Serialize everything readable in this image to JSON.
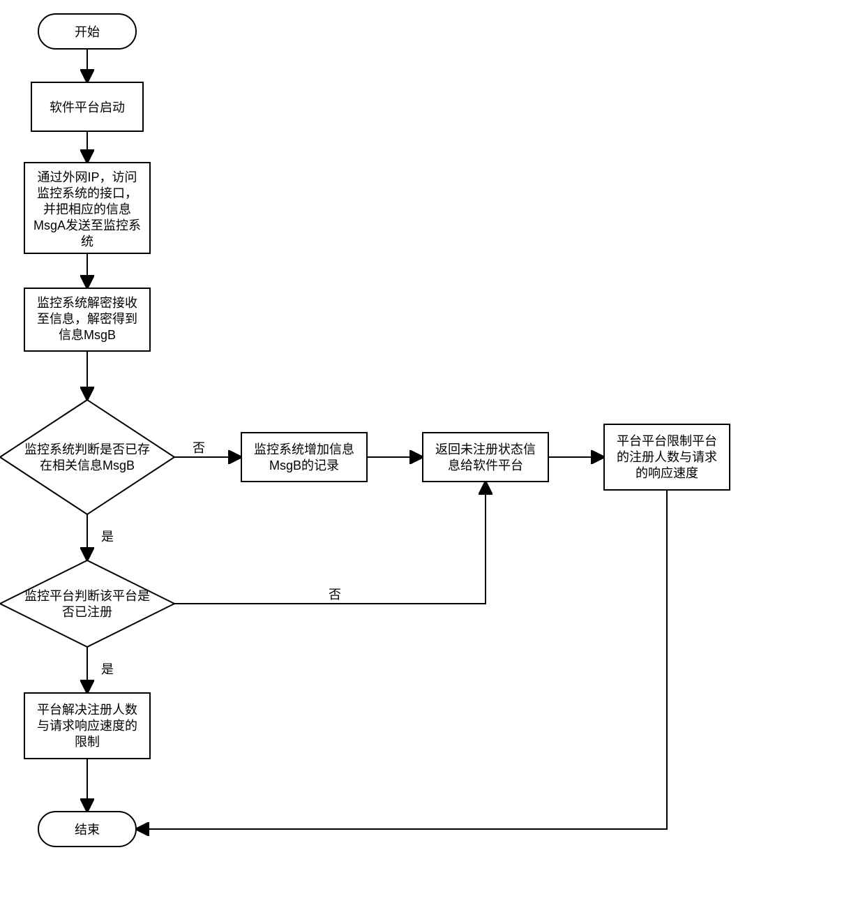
{
  "nodes": {
    "start": "开始",
    "step1": "软件平台启动",
    "step2": [
      "通过外网IP，访问",
      "监控系统的接口，",
      "并把相应的信息",
      "MsgA发送至监控系",
      "统"
    ],
    "step3": [
      "监控系统解密接收",
      "至信息，解密得到",
      "信息MsgB"
    ],
    "dec1": [
      "监控系统判断是否已存",
      "在相关信息MsgB"
    ],
    "step4": [
      "监控系统增加信息",
      "MsgB的记录"
    ],
    "step5": [
      "返回未注册状态信",
      "息给软件平台"
    ],
    "step6": [
      "平台平台限制平台",
      "的注册人数与请求",
      "的响应速度"
    ],
    "dec2": [
      "监控平台判断该平台是",
      "否已注册"
    ],
    "step7": [
      "平台解决注册人数",
      "与请求响应速度的",
      "限制"
    ],
    "end": "结束"
  },
  "labels": {
    "yes": "是",
    "no": "否"
  }
}
